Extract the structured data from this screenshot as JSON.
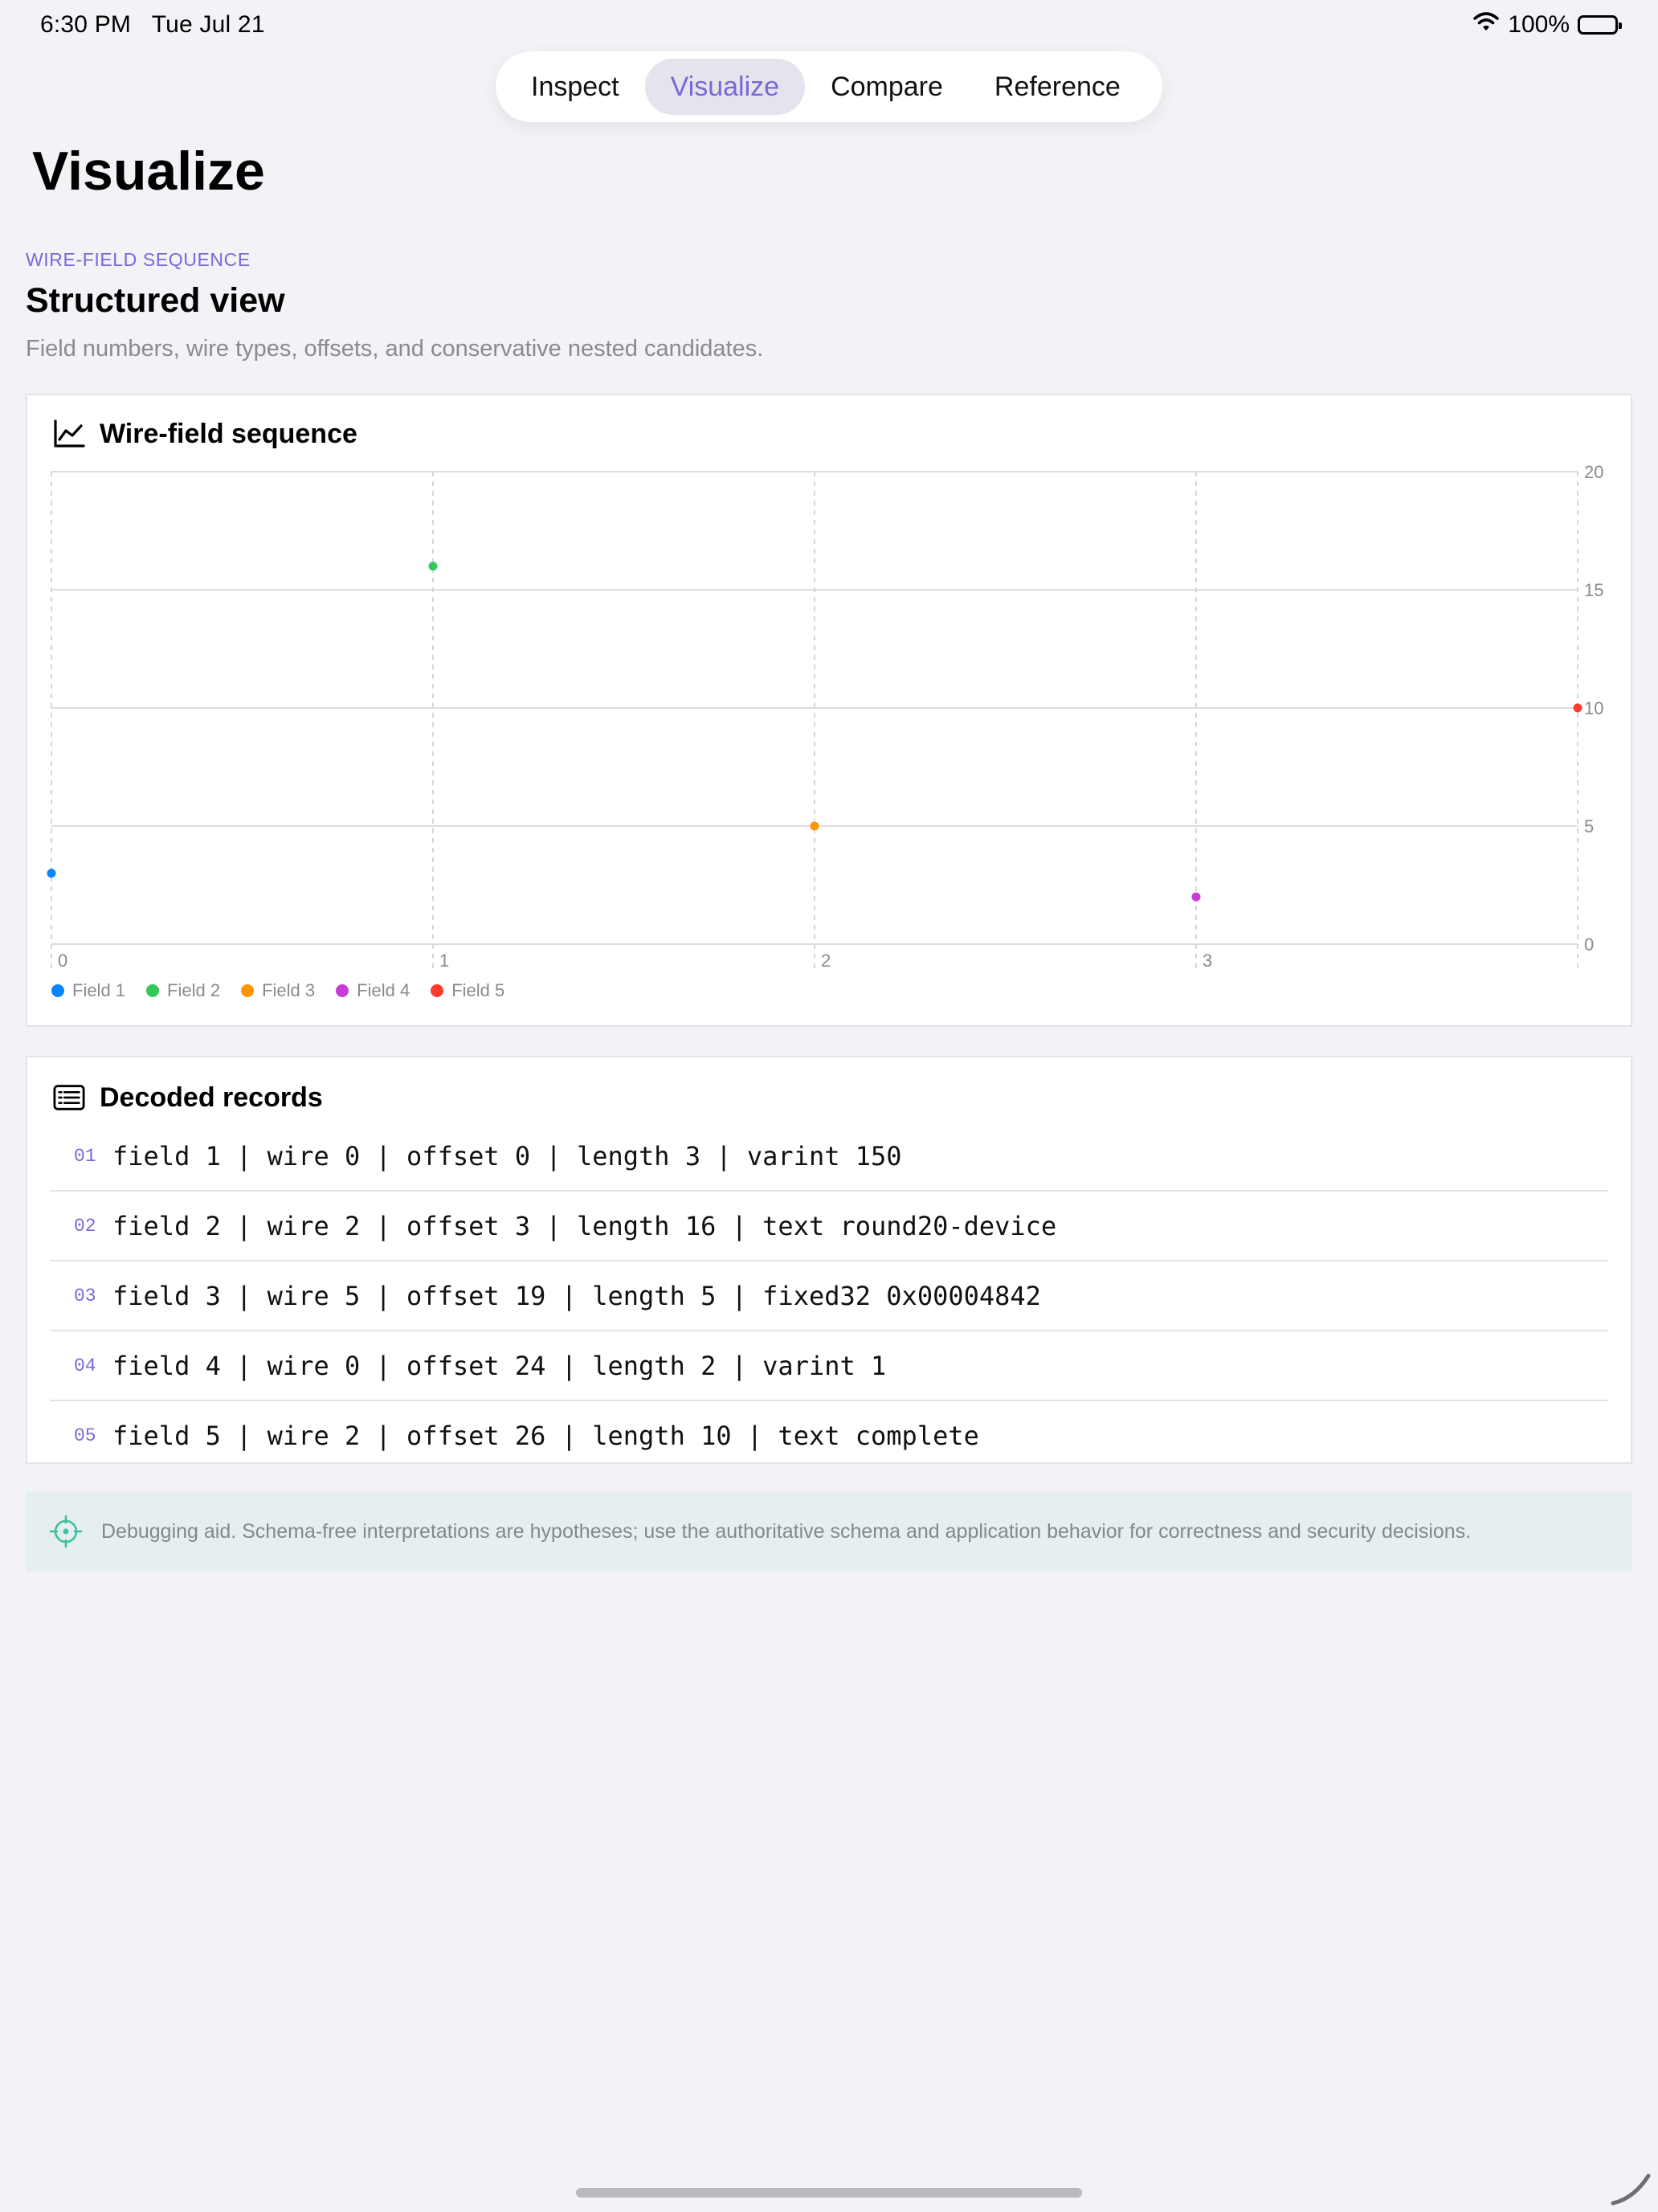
{
  "status_bar": {
    "time": "6:30 PM",
    "date": "Tue Jul 21",
    "battery": "100%"
  },
  "tabs": [
    {
      "label": "Inspect",
      "active": false
    },
    {
      "label": "Visualize",
      "active": true
    },
    {
      "label": "Compare",
      "active": false
    },
    {
      "label": "Reference",
      "active": false
    }
  ],
  "page_title": "Visualize",
  "section": {
    "eyebrow": "WIRE-FIELD SEQUENCE",
    "title": "Structured view",
    "subtitle": "Field numbers, wire types, offsets, and conservative nested candidates."
  },
  "chart_card": {
    "title": "Wire-field sequence",
    "icon": "line-chart-icon"
  },
  "chart_data": {
    "type": "scatter",
    "title": "Wire-field sequence",
    "xlabel": "",
    "ylabel": "",
    "x_ticks": [
      "0",
      "1",
      "2",
      "3"
    ],
    "y_ticks": [
      "0",
      "5",
      "10",
      "15",
      "20"
    ],
    "xlim": [
      0,
      4
    ],
    "ylim": [
      0,
      20
    ],
    "grid": true,
    "legend_position": "bottom-left",
    "series": [
      {
        "name": "Field 1",
        "color": "#0a84ff",
        "points": [
          {
            "x": 0,
            "y": 3
          }
        ]
      },
      {
        "name": "Field 2",
        "color": "#34c759",
        "points": [
          {
            "x": 1,
            "y": 16
          }
        ]
      },
      {
        "name": "Field 3",
        "color": "#ff9500",
        "points": [
          {
            "x": 2,
            "y": 5
          }
        ]
      },
      {
        "name": "Field 4",
        "color": "#c83cd8",
        "points": [
          {
            "x": 3,
            "y": 2
          }
        ]
      },
      {
        "name": "Field 5",
        "color": "#ff3b30",
        "points": [
          {
            "x": 4,
            "y": 10
          }
        ]
      }
    ]
  },
  "records_card": {
    "title": "Decoded records",
    "icon": "list-icon",
    "rows": [
      {
        "num": "01",
        "text": "field 1 | wire 0 | offset 0 | length 3 | varint 150"
      },
      {
        "num": "02",
        "text": "field 2 | wire 2 | offset 3 | length 16 | text round20-device"
      },
      {
        "num": "03",
        "text": "field 3 | wire 5 | offset 19 | length 5 | fixed32 0x00004842"
      },
      {
        "num": "04",
        "text": "field 4 | wire 0 | offset 24 | length 2 | varint 1"
      },
      {
        "num": "05",
        "text": "field 5 | wire 2 | offset 26 | length 10 | text complete"
      }
    ]
  },
  "note": {
    "icon": "crosshair-icon",
    "text": "Debugging aid. Schema-free interpretations are hypotheses; use the authoritative schema and application behavior for correctness and security decisions."
  }
}
